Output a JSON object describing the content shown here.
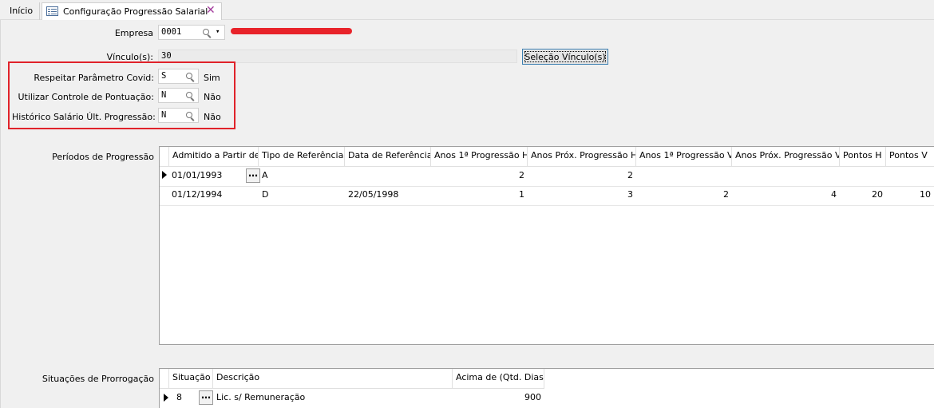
{
  "tabs": [
    {
      "label": "Início"
    },
    {
      "label": "Configuração Progressão Salarial"
    }
  ],
  "form": {
    "empresa_label": "Empresa",
    "empresa_value": "0001",
    "vinculos_label": "Vínculo(s):",
    "vinculos_value": "30",
    "selecao_button": "Seleção Vínculo(s)",
    "covid_label": "Respeitar Parâmetro Covid:",
    "covid_value": "S",
    "covid_desc": "Sim",
    "pontuacao_label": "Utilizar Controle de Pontuação:",
    "pontuacao_value": "N",
    "pontuacao_desc": "Não",
    "historico_label": "Histórico Salário Últ. Progressão:",
    "historico_value": "N",
    "historico_desc": "Não"
  },
  "periodos": {
    "label": "Períodos de Progressão",
    "columns": [
      "Admitido a Partir de",
      "Tipo de Referência",
      "Data de Referência",
      "Anos 1ª Progressão H",
      "Anos Próx. Progressão H",
      "Anos 1ª Progressão V",
      "Anos Próx. Progressão V",
      "Pontos H",
      "Pontos V"
    ],
    "rows": [
      [
        "01/01/1993",
        "A",
        "",
        "2",
        "2",
        "",
        "",
        "",
        ""
      ],
      [
        "01/12/1994",
        "D",
        "22/05/1998",
        "1",
        "3",
        "2",
        "4",
        "20",
        "10"
      ]
    ]
  },
  "situacoes": {
    "label": "Situações de Prorrogação",
    "columns": [
      "Situação",
      "Descrição",
      "Acima de (Qtd. Dias)"
    ],
    "rows": [
      [
        "8",
        "Lic. s/ Remuneração",
        "900"
      ]
    ]
  },
  "icons": {
    "tab_icon": "form-icon",
    "close": "close-icon",
    "search": "search-icon",
    "dropdown": "dropdown-arrow-icon",
    "row_indicator": "current-row-arrow-icon",
    "ellipsis": "ellipsis-button"
  },
  "colors": {
    "highlight_box": "#e0222a",
    "redaction": "#e8232a",
    "button_border": "#3c7fb1"
  }
}
